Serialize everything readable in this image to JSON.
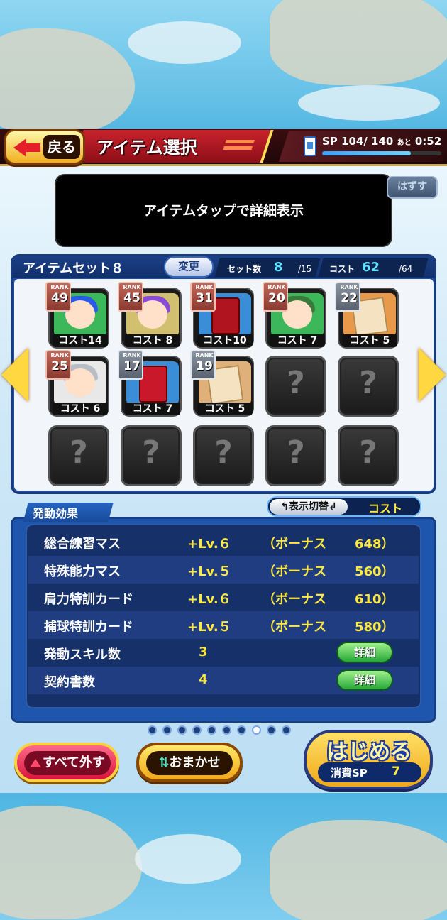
{
  "header": {
    "back_label": "戻る",
    "title": "アイテム選択",
    "sp_label": "SP",
    "sp_current": "104",
    "sp_max": "140",
    "sp_time_label": "あと",
    "sp_time": "0:52",
    "sp_fill_fraction": 0.743
  },
  "message": "アイテムタップで詳細表示",
  "hazusu_label": "はずす",
  "item_set": {
    "name": "アイテムセット８",
    "change_label": "変更",
    "count_label": "セット数",
    "count_value": "8",
    "count_max": "/15",
    "cost_label": "コスト",
    "cost_value": "62",
    "cost_max": "/64",
    "rank_label": "RANK",
    "items": [
      {
        "rank": "49",
        "cost": "コスト14",
        "kind": "character",
        "rank_color": "gold",
        "hair": "#2a5ae8",
        "frame": "#3cb85a"
      },
      {
        "rank": "45",
        "cost": "コスト 8",
        "kind": "character",
        "rank_color": "gold",
        "hair": "#8a4ad8",
        "frame": "#d0c070"
      },
      {
        "rank": "31",
        "cost": "コスト10",
        "kind": "book-exp",
        "rank_color": "gold",
        "hair": "",
        "frame": "#3a8ed8"
      },
      {
        "rank": "20",
        "cost": "コスト 7",
        "kind": "character",
        "rank_color": "gold",
        "hair": "#3a7a3a",
        "frame": "#3cb85a"
      },
      {
        "rank": "22",
        "cost": "コスト 5",
        "kind": "paper",
        "rank_color": "silver",
        "hair": "",
        "frame": "#e89a4a"
      },
      {
        "rank": "25",
        "cost": "コスト 6",
        "kind": "character",
        "rank_color": "gold",
        "hair": "#b8bcc4",
        "frame": "#e8e8e8"
      },
      {
        "rank": "17",
        "cost": "コスト 7",
        "kind": "book-blue",
        "rank_color": "silver",
        "hair": "",
        "frame": "#3a8ed8"
      },
      {
        "rank": "19",
        "cost": "コスト 5",
        "kind": "paper",
        "rank_color": "silver",
        "hair": "",
        "frame": "#e0b07a"
      }
    ],
    "empty_slots": 7,
    "empty_glyph": "?"
  },
  "effects": {
    "tab_label": "発動効果",
    "toggle_label": "表示切替",
    "toggle_value": "コスト",
    "rows": [
      {
        "name": "総合練習マス",
        "level": "+Lv.６",
        "bonus_label": "（ボーナス",
        "bonus_value": "648）"
      },
      {
        "name": "特殊能力マス",
        "level": "+Lv.５",
        "bonus_label": "（ボーナス",
        "bonus_value": "560）"
      },
      {
        "name": "肩力特訓カード",
        "level": "+Lv.６",
        "bonus_label": "（ボーナス",
        "bonus_value": "610）"
      },
      {
        "name": "捕球特訓カード",
        "level": "+Lv.５",
        "bonus_label": "（ボーナス",
        "bonus_value": "580）"
      }
    ],
    "skill_count_label": "発動スキル数",
    "skill_count": "3",
    "contract_label": "契約書数",
    "contract_count": "4",
    "detail_label": "詳細"
  },
  "pagination": {
    "total": 10,
    "current": 8
  },
  "buttons": {
    "reset_label": "すべて外す",
    "auto_label": "おまかせ",
    "start_label": "はじめる",
    "consume_label": "消費SP",
    "consume_value": "7"
  },
  "colors": {
    "accent_yellow": "#ffe840",
    "panel_blue": "#1f4f9e",
    "header_red": "#c9222c"
  }
}
